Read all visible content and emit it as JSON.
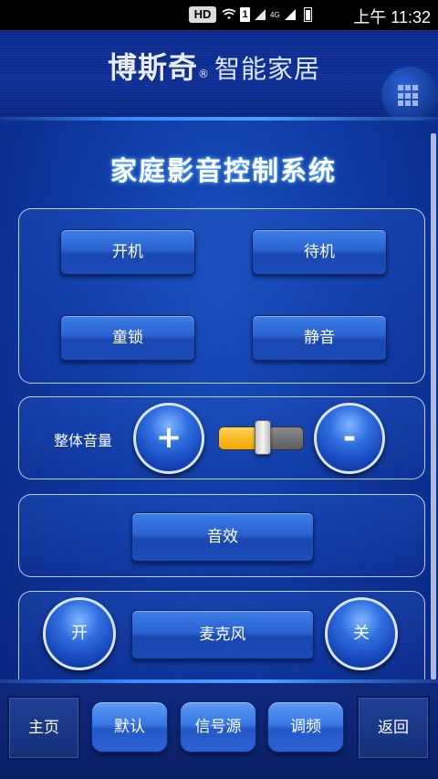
{
  "status_bar": {
    "hd_label": "HD",
    "sim_label": "1",
    "network_label": "4G",
    "time": "上午 11:32"
  },
  "header": {
    "brand_name": "博斯奇",
    "brand_registered": "®",
    "brand_tagline": "智能家居",
    "menu_icon": "grid-icon"
  },
  "main": {
    "title": "家庭影音控制系统",
    "power_panel": {
      "power_on": "开机",
      "standby": "待机",
      "child_lock": "童锁",
      "mute": "静音"
    },
    "volume_panel": {
      "label": "整体音量",
      "increase": "+",
      "decrease": "-",
      "level": 0.55
    },
    "effect_panel": {
      "effect": "音效"
    },
    "mic_panel": {
      "on": "开",
      "label": "麦克风",
      "off": "关"
    }
  },
  "bottom_nav": {
    "home": "主页",
    "default": "默认",
    "source": "信号源",
    "tuning": "调频",
    "back": "返回"
  },
  "colors": {
    "background": "#0a1f6e",
    "accent": "#3a8cff",
    "slider_fill": "#f2a500"
  }
}
